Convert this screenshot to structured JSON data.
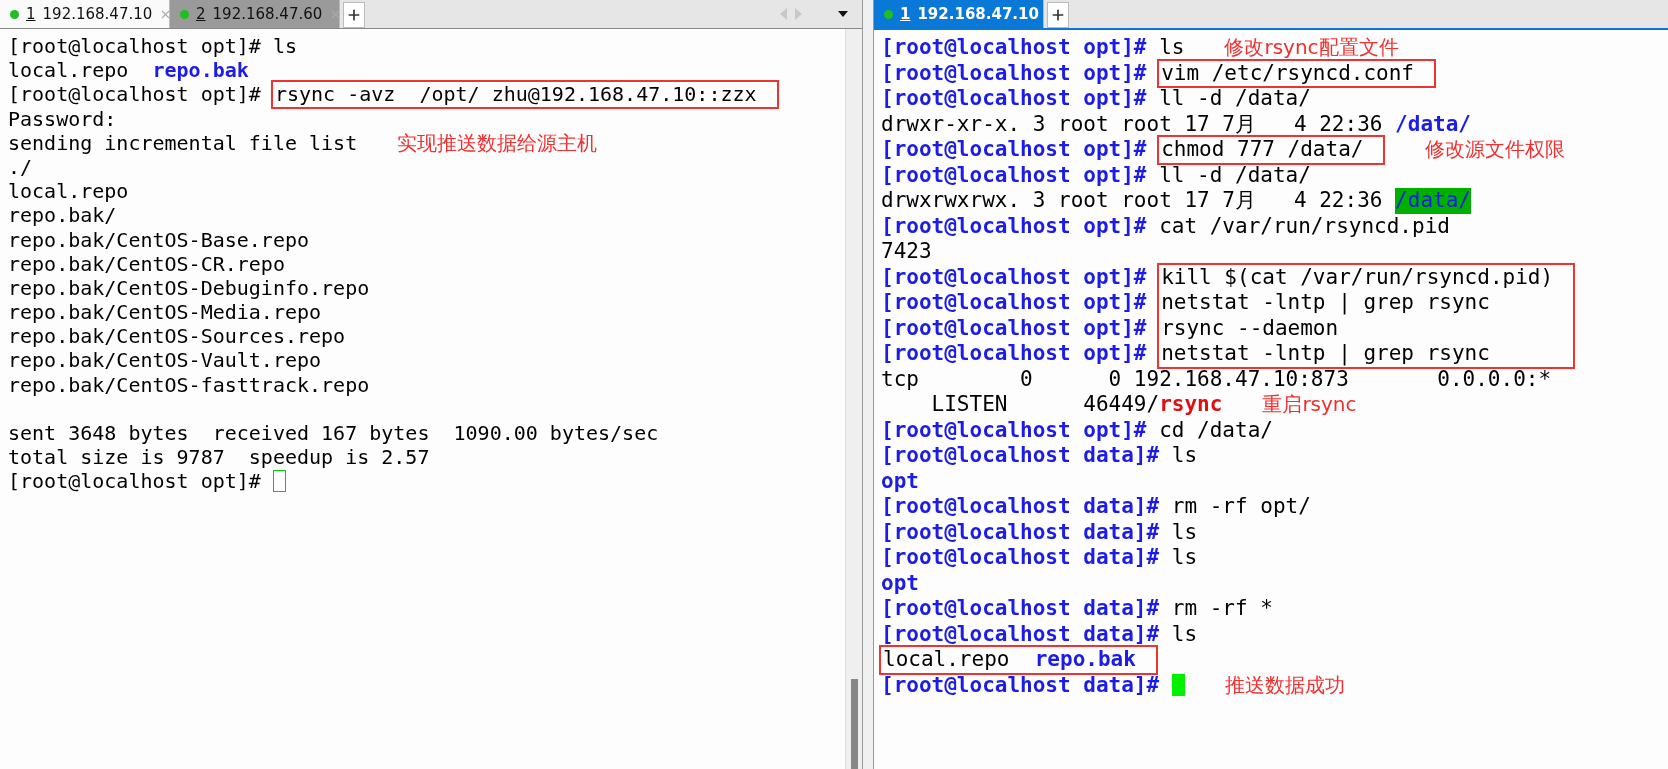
{
  "panes": [
    {
      "focused": false,
      "color_prompt": false,
      "overflow_controls": true,
      "scrollbar": true,
      "tabs": [
        {
          "number": "1",
          "label": "192.168.47.10",
          "selected": false
        },
        {
          "number": "2",
          "label": "192.168.47.60",
          "selected": true
        }
      ],
      "lines": [
        {
          "kind": "line",
          "segments": [
            {
              "kind": "prompt",
              "text": "[root@localhost opt]# "
            },
            {
              "kind": "text",
              "text": "ls"
            }
          ]
        },
        {
          "kind": "line",
          "segments": [
            {
              "kind": "text",
              "text": "local.repo  "
            },
            {
              "kind": "dir",
              "text": "repo.bak"
            }
          ]
        },
        {
          "kind": "boxed",
          "lines": [
            {
              "prompt": "[root@localhost opt]# ",
              "segments": [
                {
                  "kind": "text",
                  "text": "rsync -avz  /opt/ zhu@192.168.47.10::zzx"
                }
              ]
            }
          ]
        },
        {
          "kind": "line",
          "segments": [
            {
              "kind": "text",
              "text": "Password:"
            }
          ]
        },
        {
          "kind": "line",
          "segments": [
            {
              "kind": "text",
              "text": "sending incremental file list"
            }
          ],
          "note": "实现推送数据给源主机"
        },
        {
          "kind": "line",
          "segments": [
            {
              "kind": "text",
              "text": "./"
            }
          ]
        },
        {
          "kind": "line",
          "segments": [
            {
              "kind": "text",
              "text": "local.repo"
            }
          ]
        },
        {
          "kind": "line",
          "segments": [
            {
              "kind": "text",
              "text": "repo.bak/"
            }
          ]
        },
        {
          "kind": "line",
          "segments": [
            {
              "kind": "text",
              "text": "repo.bak/CentOS-Base.repo"
            }
          ]
        },
        {
          "kind": "line",
          "segments": [
            {
              "kind": "text",
              "text": "repo.bak/CentOS-CR.repo"
            }
          ]
        },
        {
          "kind": "line",
          "segments": [
            {
              "kind": "text",
              "text": "repo.bak/CentOS-Debuginfo.repo"
            }
          ]
        },
        {
          "kind": "line",
          "segments": [
            {
              "kind": "text",
              "text": "repo.bak/CentOS-Media.repo"
            }
          ]
        },
        {
          "kind": "line",
          "segments": [
            {
              "kind": "text",
              "text": "repo.bak/CentOS-Sources.repo"
            }
          ]
        },
        {
          "kind": "line",
          "segments": [
            {
              "kind": "text",
              "text": "repo.bak/CentOS-Vault.repo"
            }
          ]
        },
        {
          "kind": "line",
          "segments": [
            {
              "kind": "text",
              "text": "repo.bak/CentOS-fasttrack.repo"
            }
          ]
        },
        {
          "kind": "blank"
        },
        {
          "kind": "line",
          "segments": [
            {
              "kind": "text",
              "text": "sent 3648 bytes  received 167 bytes  1090.00 bytes/sec"
            }
          ]
        },
        {
          "kind": "line",
          "segments": [
            {
              "kind": "text",
              "text": "total size is 9787  speedup is 2.57"
            }
          ]
        },
        {
          "kind": "line",
          "segments": [
            {
              "kind": "prompt",
              "text": "[root@localhost opt]# "
            }
          ],
          "cursor": true
        }
      ]
    },
    {
      "focused": true,
      "color_prompt": true,
      "overflow_controls": false,
      "scrollbar": false,
      "tabs": [
        {
          "number": "1",
          "label": "192.168.47.10",
          "selected": true
        }
      ],
      "lines": [
        {
          "kind": "line",
          "segments": [
            {
              "kind": "prompt",
              "text": "[root@localhost opt]# "
            },
            {
              "kind": "text",
              "text": "ls"
            }
          ],
          "note": "修改rsync配置文件"
        },
        {
          "kind": "boxed",
          "lines": [
            {
              "prompt": "[root@localhost opt]# ",
              "segments": [
                {
                  "kind": "text",
                  "text": "vim /etc/rsyncd.conf"
                }
              ]
            }
          ]
        },
        {
          "kind": "line",
          "segments": [
            {
              "kind": "prompt",
              "text": "[root@localhost opt]# "
            },
            {
              "kind": "text",
              "text": "ll -d /data/"
            }
          ]
        },
        {
          "kind": "line",
          "segments": [
            {
              "kind": "text",
              "text": "drwxr-xr-x. 3 root root 17 7月   4 22:36 "
            },
            {
              "kind": "dir",
              "text": "/data/"
            }
          ]
        },
        {
          "kind": "boxed",
          "lines": [
            {
              "prompt": "[root@localhost opt]# ",
              "segments": [
                {
                  "kind": "text",
                  "text": "chmod 777 /data/"
                }
              ]
            }
          ],
          "note": "修改源文件权限"
        },
        {
          "kind": "line",
          "segments": [
            {
              "kind": "prompt",
              "text": "[root@localhost opt]# "
            },
            {
              "kind": "text",
              "text": "ll -d /data/"
            }
          ]
        },
        {
          "kind": "line",
          "segments": [
            {
              "kind": "text",
              "text": "drwxrwxrwx. 3 root root 17 7月   4 22:36 "
            },
            {
              "kind": "dir_hl",
              "text": "/data/"
            }
          ]
        },
        {
          "kind": "line",
          "segments": [
            {
              "kind": "prompt",
              "text": "[root@localhost opt]# "
            },
            {
              "kind": "text",
              "text": "cat /var/run/rsyncd.pid"
            }
          ]
        },
        {
          "kind": "line",
          "segments": [
            {
              "kind": "text",
              "text": "7423"
            }
          ]
        },
        {
          "kind": "boxed",
          "lines": [
            {
              "prompt": "[root@localhost opt]# ",
              "segments": [
                {
                  "kind": "text",
                  "text": "kill $(cat /var/run/rsyncd.pid)"
                }
              ]
            },
            {
              "prompt": "[root@localhost opt]# ",
              "segments": [
                {
                  "kind": "text",
                  "text": "netstat -lntp | grep rsync"
                }
              ]
            },
            {
              "prompt": "[root@localhost opt]# ",
              "segments": [
                {
                  "kind": "text",
                  "text": "rsync --daemon"
                }
              ]
            },
            {
              "prompt": "[root@localhost opt]# ",
              "segments": [
                {
                  "kind": "text",
                  "text": "netstat -lntp | grep rsync"
                }
              ]
            }
          ]
        },
        {
          "kind": "line",
          "segments": [
            {
              "kind": "text",
              "text": "tcp        0      0 192.168.47.10:873       0.0.0.0:*"
            }
          ]
        },
        {
          "kind": "line",
          "segments": [
            {
              "kind": "text",
              "text": "    LISTEN      46449/"
            },
            {
              "kind": "exec",
              "text": "rsync"
            }
          ],
          "note": "重启rsync"
        },
        {
          "kind": "line",
          "segments": [
            {
              "kind": "prompt",
              "text": "[root@localhost opt]# "
            },
            {
              "kind": "text",
              "text": "cd /data/"
            }
          ]
        },
        {
          "kind": "line",
          "segments": [
            {
              "kind": "prompt",
              "text": "[root@localhost data]# "
            },
            {
              "kind": "text",
              "text": "ls"
            }
          ]
        },
        {
          "kind": "line",
          "segments": [
            {
              "kind": "dir",
              "text": "opt"
            }
          ]
        },
        {
          "kind": "line",
          "segments": [
            {
              "kind": "prompt",
              "text": "[root@localhost data]# "
            },
            {
              "kind": "text",
              "text": "rm -rf opt/"
            }
          ]
        },
        {
          "kind": "line",
          "segments": [
            {
              "kind": "prompt",
              "text": "[root@localhost data]# "
            },
            {
              "kind": "text",
              "text": "ls"
            }
          ]
        },
        {
          "kind": "line",
          "segments": [
            {
              "kind": "prompt",
              "text": "[root@localhost data]# "
            },
            {
              "kind": "text",
              "text": "ls"
            }
          ]
        },
        {
          "kind": "line",
          "segments": [
            {
              "kind": "dir",
              "text": "opt"
            }
          ]
        },
        {
          "kind": "line",
          "segments": [
            {
              "kind": "prompt",
              "text": "[root@localhost data]# "
            },
            {
              "kind": "text",
              "text": "rm -rf *"
            }
          ]
        },
        {
          "kind": "line",
          "segments": [
            {
              "kind": "prompt",
              "text": "[root@localhost data]# "
            },
            {
              "kind": "text",
              "text": "ls"
            }
          ]
        },
        {
          "kind": "boxed",
          "lines": [
            {
              "segments": [
                {
                  "kind": "text",
                  "text": "local.repo  "
                },
                {
                  "kind": "dir",
                  "text": "repo.bak"
                }
              ]
            }
          ]
        },
        {
          "kind": "line",
          "segments": [
            {
              "kind": "prompt",
              "text": "[root@localhost data]# "
            }
          ],
          "cursor": true,
          "note": "推送数据成功"
        }
      ]
    }
  ]
}
